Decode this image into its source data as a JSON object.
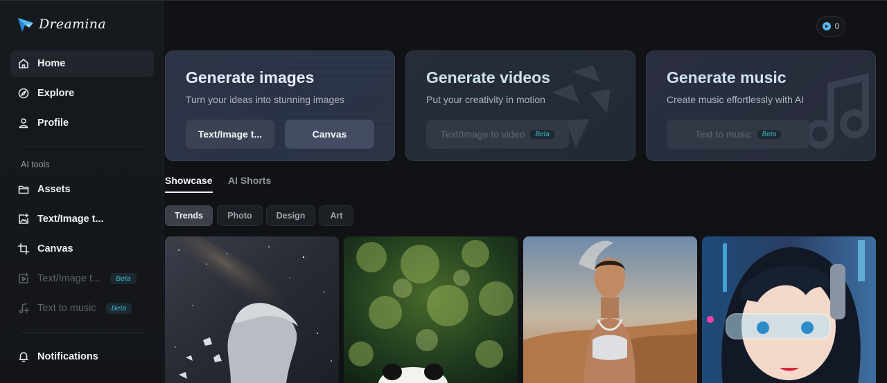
{
  "app": {
    "name": "Dreamina"
  },
  "sidebar": {
    "items": [
      {
        "label": "Home"
      },
      {
        "label": "Explore"
      },
      {
        "label": "Profile"
      }
    ],
    "section_label": "AI tools",
    "tools": [
      {
        "label": "Assets"
      },
      {
        "label": "Text/Image t..."
      },
      {
        "label": "Canvas"
      },
      {
        "label": "Text/Image t...",
        "badge": "Beta"
      },
      {
        "label": "Text to music",
        "badge": "Beta"
      }
    ],
    "notifications": "Notifications"
  },
  "credits": {
    "value": "0"
  },
  "cards": [
    {
      "title": "Generate images",
      "subtitle": "Turn your ideas into stunning images",
      "buttons": [
        "Text/Image t...",
        "Canvas"
      ]
    },
    {
      "title": "Generate videos",
      "subtitle": "Put your creativity in motion",
      "buttons": [
        "Text/Image to video"
      ],
      "badge": "Beta"
    },
    {
      "title": "Generate music",
      "subtitle": "Create music effortlessly with AI",
      "buttons": [
        "Text to music"
      ],
      "badge": "Beta"
    }
  ],
  "tabs": [
    {
      "label": "Showcase"
    },
    {
      "label": "AI Shorts"
    }
  ],
  "filters": [
    {
      "label": "Trends"
    },
    {
      "label": "Photo"
    },
    {
      "label": "Design"
    },
    {
      "label": "Art"
    }
  ],
  "colors": {
    "accent": "#3fb6c9",
    "active_bg": "#22262c",
    "card_bg": "#2d3447"
  }
}
